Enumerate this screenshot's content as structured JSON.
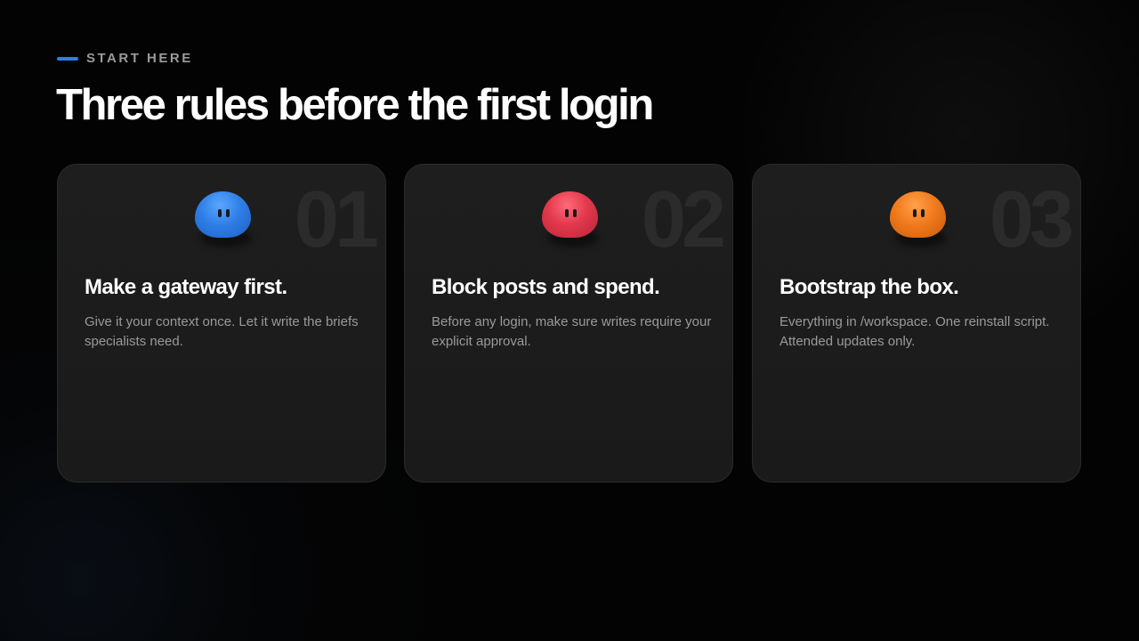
{
  "header": {
    "eyebrow": "START HERE",
    "title": "Three rules before the first login"
  },
  "colors": {
    "accent": "#2f7de1",
    "mascot_blue": "#2f7fe6",
    "mascot_red": "#e2384c",
    "mascot_orange": "#f07a1c"
  },
  "cards": [
    {
      "number": "01",
      "mascot_icon": "blue-blob-mascot-icon",
      "title": "Make a gateway first.",
      "description": "Give it your context once. Let it write the briefs specialists need."
    },
    {
      "number": "02",
      "mascot_icon": "red-blob-mascot-icon",
      "title": "Block posts and spend.",
      "description": "Before any login, make sure writes require your explicit approval."
    },
    {
      "number": "03",
      "mascot_icon": "orange-blob-mascot-icon",
      "title": "Bootstrap the box.",
      "description": "Everything in /workspace. One reinstall script. Attended updates only."
    }
  ]
}
